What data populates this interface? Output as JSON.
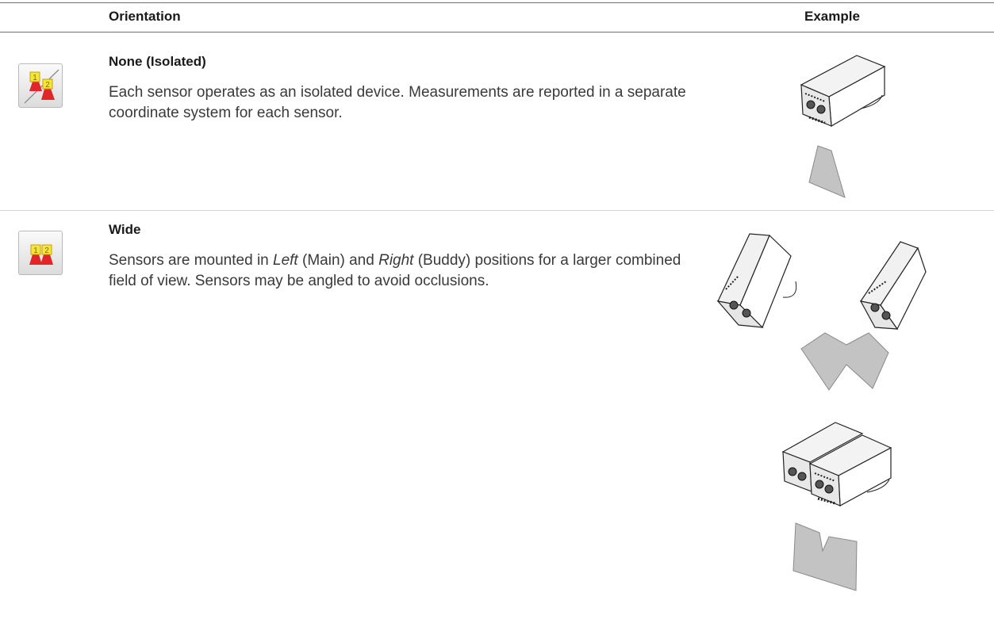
{
  "table": {
    "header": {
      "orientation": "Orientation",
      "example": "Example"
    },
    "rows": [
      {
        "icon": "isolated-sensors-icon",
        "title": "None (Isolated)",
        "description": "Each sensor operates as an isolated device. Measurements are reported in a separate coordinate system for each sensor."
      },
      {
        "icon": "wide-sensors-icon",
        "title": "Wide",
        "description_parts": {
          "p1": "Sensors are mounted in ",
          "left": "Left",
          "p2": " (Main) and ",
          "right": "Right",
          "p3": " (Buddy) positions for a larger combined field of view. Sensors may be angled to avoid occlusions."
        }
      }
    ]
  },
  "icon_badges": {
    "one": "1",
    "two": "2"
  },
  "colors": {
    "badge_yellow": "#f4e53c",
    "beam_red": "#e0262b",
    "target_gray": "#c3c3c3"
  }
}
